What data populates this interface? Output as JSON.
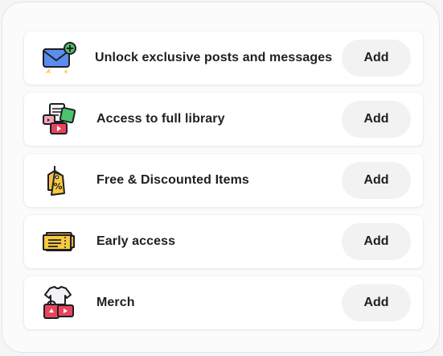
{
  "items": [
    {
      "label": "Unlock exclusive posts and messages",
      "button": "Add",
      "icon": "envelope-plus-icon"
    },
    {
      "label": "Access to full library",
      "button": "Add",
      "icon": "media-library-icon"
    },
    {
      "label": "Free & Discounted Items",
      "button": "Add",
      "icon": "discount-tag-icon"
    },
    {
      "label": "Early access",
      "button": "Add",
      "icon": "ticket-icon"
    },
    {
      "label": "Merch",
      "button": "Add",
      "icon": "merch-shirt-bag-icon"
    }
  ],
  "colors": {
    "accent_blue": "#5b8def",
    "accent_red": "#e8455c",
    "accent_yellow": "#f8c93e",
    "accent_green": "#4cc36b",
    "button_bg": "#f2f2f3",
    "text": "#1f1f23"
  }
}
